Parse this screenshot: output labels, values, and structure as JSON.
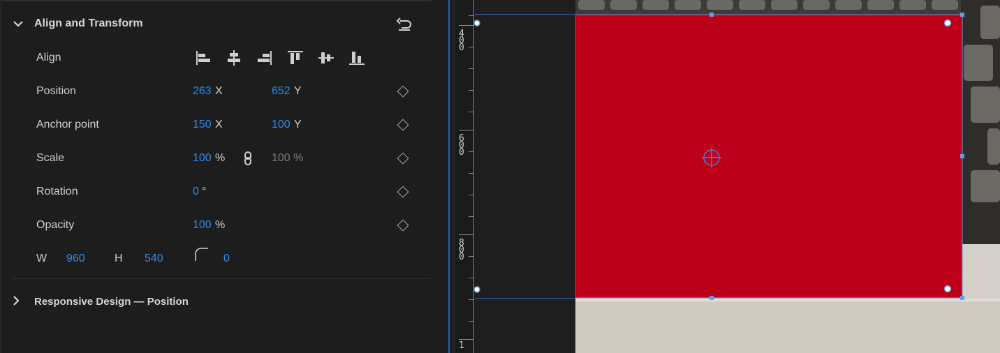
{
  "section": {
    "title": "Align and Transform",
    "expanded": true
  },
  "rows": {
    "align": {
      "label": "Align"
    },
    "position": {
      "label": "Position",
      "x": "263",
      "x_unit": "X",
      "y": "652",
      "y_unit": "Y"
    },
    "anchor": {
      "label": "Anchor point",
      "x": "150",
      "x_unit": "X",
      "y": "100",
      "y_unit": "Y"
    },
    "scale": {
      "label": "Scale",
      "value": "100",
      "unit": "%",
      "linked_value": "100 %"
    },
    "rotation": {
      "label": "Rotation",
      "value": "0",
      "unit": "°"
    },
    "opacity": {
      "label": "Opacity",
      "value": "100",
      "unit": "%"
    },
    "size": {
      "w_label": "W",
      "w": "960",
      "h_label": "H",
      "h": "540",
      "radius": "0"
    }
  },
  "responsive": {
    "title": "Responsive Design — Position"
  },
  "ruler": {
    "labels": [
      "4\n0\n0",
      "6\n0\n0",
      "8\n0\n0",
      "1"
    ]
  },
  "icons": {
    "align": [
      "align-left-icon",
      "align-center-h-icon",
      "align-right-icon",
      "align-top-icon",
      "align-middle-v-icon",
      "align-bottom-icon"
    ],
    "reset": "reset-icon",
    "link": "link-icon",
    "corner": "corner-radius-icon",
    "keyframe": "keyframe-diamond-icon",
    "crosshair": "anchor-crosshair-icon"
  },
  "colors": {
    "accent": "#2d8ceb",
    "shape_fill": "#bd0019",
    "panel_bg": "#1d1d1d",
    "selection": "#6b9ad8"
  }
}
